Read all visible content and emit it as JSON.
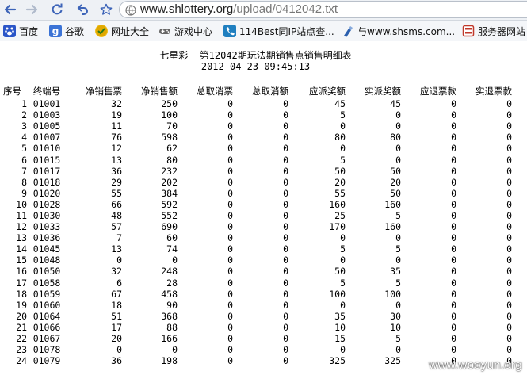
{
  "browser": {
    "url_host": "www.shlottery.org",
    "url_path": "/upload/0412042.txt"
  },
  "bookmarks": [
    {
      "label": "百度",
      "icon": "baidu-paw-icon",
      "color": "#2a55c8"
    },
    {
      "label": "谷歌",
      "icon": "google-g-icon",
      "color": "#3b73d6"
    },
    {
      "label": "网址大全",
      "icon": "web-directory-icon",
      "color": "#d8a400"
    },
    {
      "label": "游戏中心",
      "icon": "gamepad-icon",
      "color": "#666"
    },
    {
      "label": "114Best同IP站点查...",
      "icon": "phone-icon",
      "color": "#1f7fc0"
    },
    {
      "label": "与www.shsms.com...",
      "icon": "tool-icon",
      "color": "#2b5fae"
    },
    {
      "label": "服务器网站",
      "icon": "server-icon",
      "color": "#c0392b"
    }
  ],
  "document": {
    "title": "七星彩  第12042期玩法期销售点销售明细表",
    "timestamp": "2012-04-23 09:45:13",
    "columns": [
      "序号",
      "终端号",
      "净销售票",
      "净销售额",
      "总取消票",
      "总取消额",
      "应派奖额",
      "实派奖额",
      "应退票款",
      "实退票款"
    ],
    "rows": [
      [
        "1",
        "01001",
        "32",
        "250",
        "0",
        "0",
        "45",
        "45",
        "0",
        "0"
      ],
      [
        "2",
        "01003",
        "19",
        "100",
        "0",
        "0",
        "5",
        "0",
        "0",
        "0"
      ],
      [
        "3",
        "01005",
        "11",
        "70",
        "0",
        "0",
        "0",
        "0",
        "0",
        "0"
      ],
      [
        "4",
        "01007",
        "76",
        "598",
        "0",
        "0",
        "80",
        "80",
        "0",
        "0"
      ],
      [
        "5",
        "01010",
        "12",
        "62",
        "0",
        "0",
        "0",
        "0",
        "0",
        "0"
      ],
      [
        "6",
        "01015",
        "13",
        "80",
        "0",
        "0",
        "5",
        "0",
        "0",
        "0"
      ],
      [
        "7",
        "01017",
        "36",
        "232",
        "0",
        "0",
        "50",
        "50",
        "0",
        "0"
      ],
      [
        "8",
        "01018",
        "29",
        "202",
        "0",
        "0",
        "20",
        "20",
        "0",
        "0"
      ],
      [
        "9",
        "01020",
        "55",
        "384",
        "0",
        "0",
        "55",
        "50",
        "0",
        "0"
      ],
      [
        "10",
        "01028",
        "66",
        "592",
        "0",
        "0",
        "160",
        "160",
        "0",
        "0"
      ],
      [
        "11",
        "01030",
        "48",
        "552",
        "0",
        "0",
        "25",
        "5",
        "0",
        "0"
      ],
      [
        "12",
        "01033",
        "57",
        "690",
        "0",
        "0",
        "170",
        "160",
        "0",
        "0"
      ],
      [
        "13",
        "01036",
        "7",
        "60",
        "0",
        "0",
        "0",
        "0",
        "0",
        "0"
      ],
      [
        "14",
        "01045",
        "13",
        "74",
        "0",
        "0",
        "5",
        "5",
        "0",
        "0"
      ],
      [
        "15",
        "01048",
        "0",
        "0",
        "0",
        "0",
        "0",
        "0",
        "0",
        "0"
      ],
      [
        "16",
        "01050",
        "32",
        "248",
        "0",
        "0",
        "50",
        "35",
        "0",
        "0"
      ],
      [
        "17",
        "01058",
        "6",
        "28",
        "0",
        "0",
        "5",
        "5",
        "0",
        "0"
      ],
      [
        "18",
        "01059",
        "67",
        "458",
        "0",
        "0",
        "100",
        "100",
        "0",
        "0"
      ],
      [
        "19",
        "01060",
        "18",
        "90",
        "0",
        "0",
        "0",
        "0",
        "0",
        "0"
      ],
      [
        "20",
        "01064",
        "51",
        "368",
        "0",
        "0",
        "35",
        "30",
        "0",
        "0"
      ],
      [
        "21",
        "01066",
        "17",
        "88",
        "0",
        "0",
        "10",
        "10",
        "0",
        "0"
      ],
      [
        "22",
        "01067",
        "20",
        "166",
        "0",
        "0",
        "15",
        "5",
        "0",
        "0"
      ],
      [
        "23",
        "01078",
        "0",
        "0",
        "0",
        "0",
        "0",
        "0",
        "0",
        "0"
      ],
      [
        "24",
        "01079",
        "36",
        "198",
        "0",
        "0",
        "325",
        "325",
        "0",
        "0"
      ]
    ]
  },
  "watermark": "www.wooyun.org"
}
